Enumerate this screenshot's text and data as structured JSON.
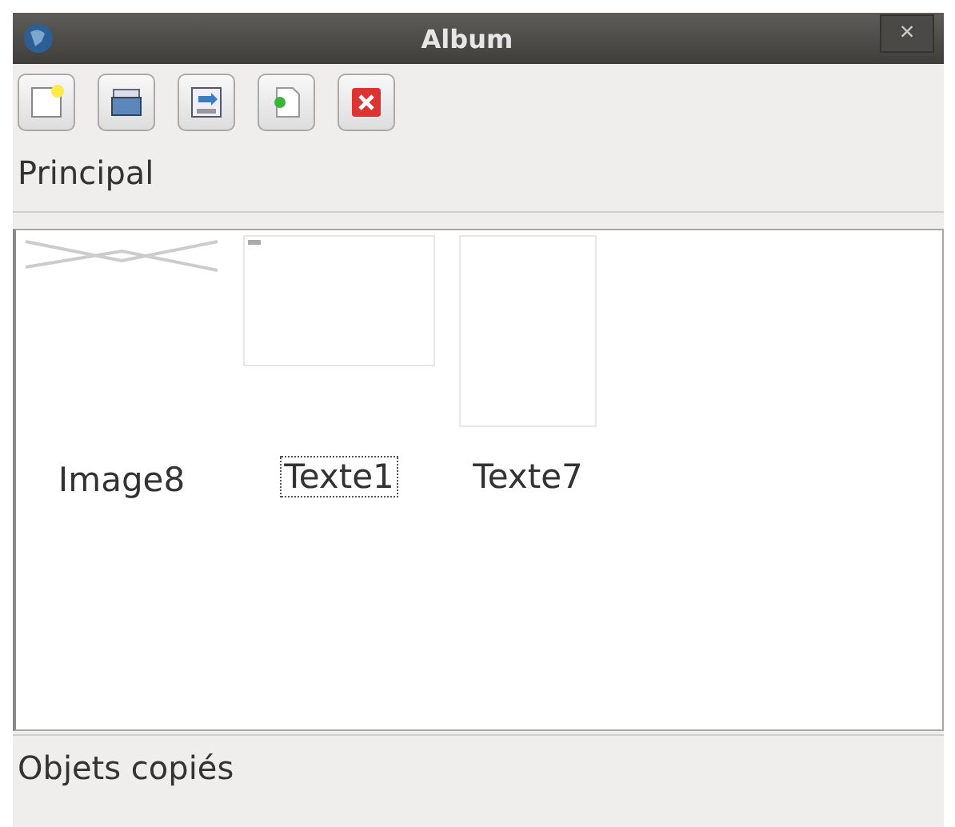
{
  "window": {
    "title": "Album",
    "close": "×"
  },
  "toolbar": [
    {
      "kind": "new"
    },
    {
      "kind": "open"
    },
    {
      "kind": "save"
    },
    {
      "kind": "import"
    },
    {
      "kind": "delete"
    }
  ],
  "sections": [
    {
      "title": "Principal"
    }
  ],
  "items": [
    {
      "label": "Image8",
      "kind": "image",
      "selected": false
    },
    {
      "label": "Texte1",
      "kind": "text",
      "selected": true
    },
    {
      "label": "Texte7",
      "kind": "tall",
      "selected": false
    }
  ],
  "footer": {
    "title": "Objets copiés"
  }
}
